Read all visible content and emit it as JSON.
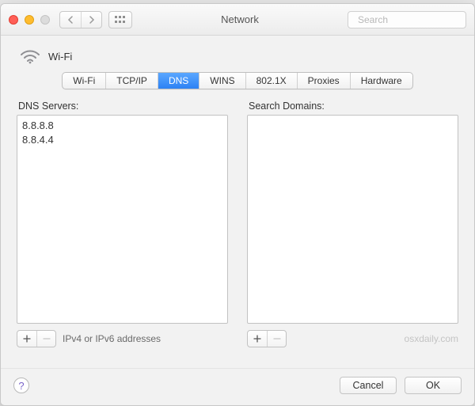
{
  "window": {
    "title": "Network",
    "search_placeholder": "Search"
  },
  "header": {
    "interface_name": "Wi-Fi"
  },
  "tabs": [
    {
      "label": "Wi-Fi",
      "id": "wifi",
      "active": false
    },
    {
      "label": "TCP/IP",
      "id": "tcpip",
      "active": false
    },
    {
      "label": "DNS",
      "id": "dns",
      "active": true
    },
    {
      "label": "WINS",
      "id": "wins",
      "active": false
    },
    {
      "label": "802.1X",
      "id": "8021x",
      "active": false
    },
    {
      "label": "Proxies",
      "id": "proxies",
      "active": false
    },
    {
      "label": "Hardware",
      "id": "hardware",
      "active": false
    }
  ],
  "dns_panel": {
    "label": "DNS Servers:",
    "entries": [
      "8.8.8.8",
      "8.8.4.4"
    ],
    "hint": "IPv4 or IPv6 addresses"
  },
  "search_domains_panel": {
    "label": "Search Domains:",
    "entries": [],
    "ghost": "osxdaily.com"
  },
  "footer": {
    "cancel": "Cancel",
    "ok": "OK"
  }
}
